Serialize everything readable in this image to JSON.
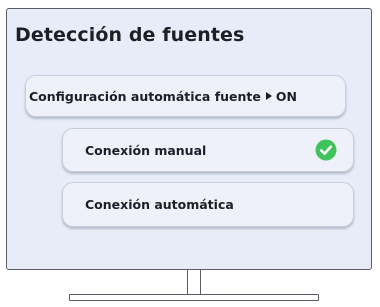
{
  "screen": {
    "title": "Detección de fuentes"
  },
  "menu": {
    "auto_config": {
      "label": "Configuración automática fuente",
      "value": "ON",
      "icon": "play-arrow-icon"
    },
    "manual": {
      "label": "Conexión manual",
      "selected": true,
      "icon": "check-circle-icon"
    },
    "automatic": {
      "label": "Conexión automática"
    }
  },
  "colors": {
    "screen_bg": "#e7ecf8",
    "button_bg": "#eef1f9",
    "text": "#1d1f25",
    "check_green": "#3ec45a",
    "frame": "#585c66"
  }
}
